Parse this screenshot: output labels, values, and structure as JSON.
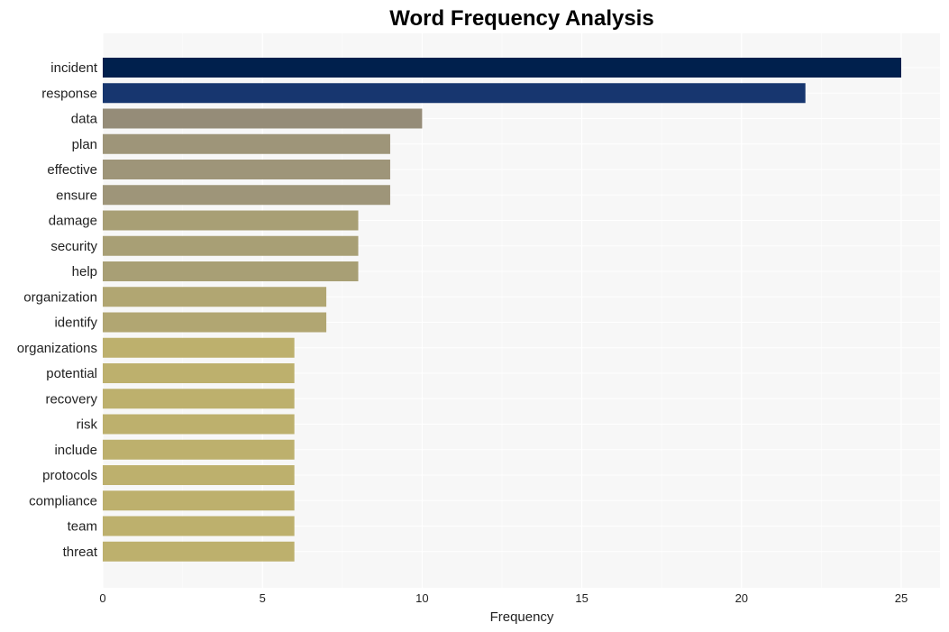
{
  "chart_data": {
    "type": "bar",
    "orientation": "horizontal",
    "title": "Word Frequency Analysis",
    "xlabel": "Frequency",
    "ylabel": "",
    "xlim": [
      0,
      26.2
    ],
    "xticks": [
      0,
      5,
      10,
      15,
      20,
      25
    ],
    "grid": true,
    "legend": "none",
    "categories": [
      "incident",
      "response",
      "data",
      "plan",
      "effective",
      "ensure",
      "damage",
      "security",
      "help",
      "organization",
      "identify",
      "organizations",
      "potential",
      "recovery",
      "risk",
      "include",
      "protocols",
      "compliance",
      "team",
      "threat"
    ],
    "values": [
      25,
      22,
      10,
      9,
      9,
      9,
      8,
      8,
      8,
      7,
      7,
      6,
      6,
      6,
      6,
      6,
      6,
      6,
      6,
      6
    ],
    "colors": [
      "#00204d",
      "#17366f",
      "#958c78",
      "#9e9579",
      "#9e9579",
      "#9e9579",
      "#a89f75",
      "#a89f75",
      "#a89f75",
      "#b1a672",
      "#b1a672",
      "#bdb06d",
      "#bdb06d",
      "#bdb06d",
      "#bdb06d",
      "#bdb06d",
      "#bdb06d",
      "#bdb06d",
      "#bdb06d",
      "#bdb06d"
    ]
  }
}
